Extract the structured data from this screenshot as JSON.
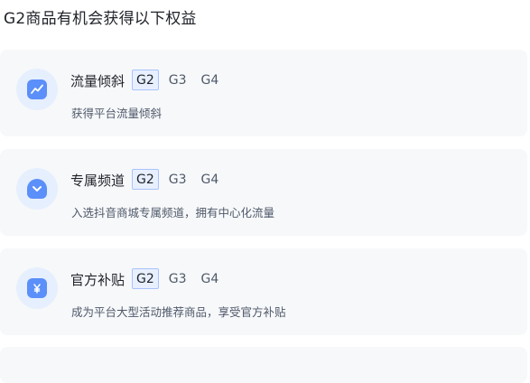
{
  "page": {
    "title": "G2商品有机会获得以下权益"
  },
  "colors": {
    "card_bg": "#f7f8fa",
    "icon_circle": "#e6effd",
    "icon_fill": "#5b8ff9",
    "active_tag_bg": "#e8f0ff",
    "active_tag_border": "#a9c3fb"
  },
  "benefits": [
    {
      "icon": "trend-chart-icon",
      "title": "流量倾斜",
      "tags": [
        "G2",
        "G3",
        "G4"
      ],
      "active_tag": "G2",
      "description": "获得平台流量倾斜"
    },
    {
      "icon": "chevron-badge-icon",
      "title": "专属频道",
      "tags": [
        "G2",
        "G3",
        "G4"
      ],
      "active_tag": "G2",
      "description": "入选抖音商城专属频道，拥有中心化流量"
    },
    {
      "icon": "subsidy-coupon-icon",
      "title": "官方补贴",
      "tags": [
        "G2",
        "G3",
        "G4"
      ],
      "active_tag": "G2",
      "description": "成为平台大型活动推荐商品，享受官方补贴"
    }
  ]
}
